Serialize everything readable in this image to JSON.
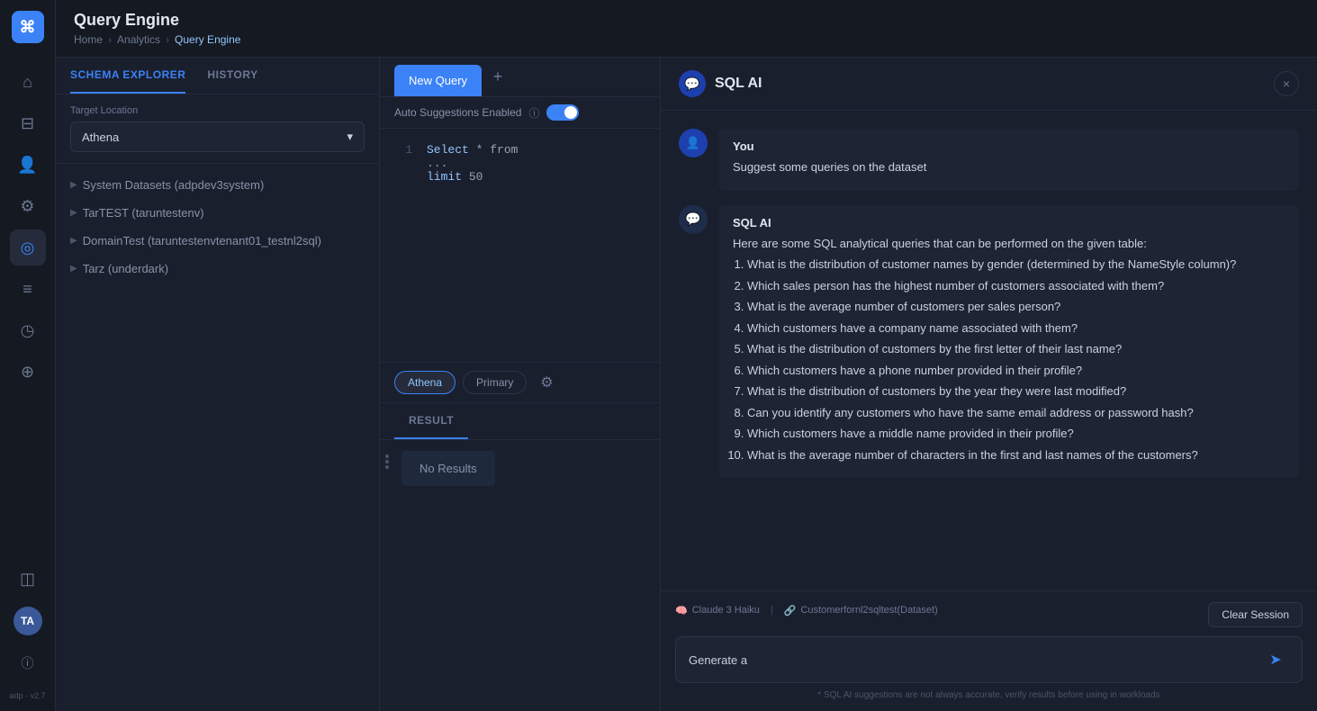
{
  "app": {
    "title": "Query Engine",
    "version": "adp - v2.7",
    "breadcrumb": {
      "home": "Home",
      "analytics": "Analytics",
      "current": "Query Engine"
    }
  },
  "sidebar_icons": [
    {
      "name": "home-icon",
      "symbol": "⌂"
    },
    {
      "name": "filter-icon",
      "symbol": "⊟"
    },
    {
      "name": "users-icon",
      "symbol": "👤"
    },
    {
      "name": "settings-icon",
      "symbol": "⚙"
    },
    {
      "name": "person-active-icon",
      "symbol": "◎"
    },
    {
      "name": "chart-icon",
      "symbol": "≡"
    },
    {
      "name": "clock-icon",
      "symbol": "◷"
    },
    {
      "name": "badge-icon",
      "symbol": "⊕"
    },
    {
      "name": "bag-icon",
      "symbol": "◫"
    }
  ],
  "schema": {
    "tabs": [
      {
        "label": "SCHEMA EXPLORER"
      },
      {
        "label": "HISTORY"
      }
    ],
    "target_location_label": "Target Location",
    "target_location_value": "Athena",
    "tree_items": [
      {
        "label": "System Datasets (adpdev3system)"
      },
      {
        "label": "TarTEST (taruntestenv)"
      },
      {
        "label": "DomainTest (taruntestenvtenant01_testnl2sql)"
      },
      {
        "label": "Tarz (underdark)"
      }
    ]
  },
  "query_editor": {
    "tab_label": "New Query",
    "add_tab_symbol": "+",
    "auto_suggestions_label": "Auto Suggestions Enabled",
    "code_lines": [
      {
        "num": "1",
        "code": "Select * from"
      },
      {
        "num": "",
        "code": "..."
      },
      {
        "num": "",
        "code": "limit 50"
      }
    ],
    "db_badge": "Athena",
    "schema_badge": "Primary",
    "result_label": "RESULT",
    "no_results": "No Results"
  },
  "ai_panel": {
    "title": "SQL AI",
    "close_symbol": "×",
    "messages": [
      {
        "sender": "user",
        "sender_label": "You",
        "text": "Suggest some queries on the dataset"
      },
      {
        "sender": "ai",
        "sender_label": "SQL AI",
        "intro": "Here are some SQL analytical queries that can be performed on the given table:",
        "items": [
          "What is the distribution of customer names by gender (determined by the NameStyle column)?",
          "Which sales person has the highest number of customers associated with them?",
          "What is the average number of customers per sales person?",
          "Which customers have a company name associated with them?",
          "What is the distribution of customers by the first letter of their last name?",
          "Which customers have a phone number provided in their profile?",
          "What is the distribution of customers by the year they were last modified?",
          "Can you identify any customers who have the same email address or password hash?",
          "Which customers have a middle name provided in their profile?",
          "What is the average number of characters in the first and last names of the customers?"
        ]
      }
    ],
    "model_label": "Claude 3 Haiku",
    "dataset_label": "Customerfornl2sqltest(Dataset)",
    "clear_session_label": "Clear Session",
    "input_value": "Generate a",
    "disclaimer": "* SQL AI suggestions are not always accurate, verify results before using in workloads"
  }
}
